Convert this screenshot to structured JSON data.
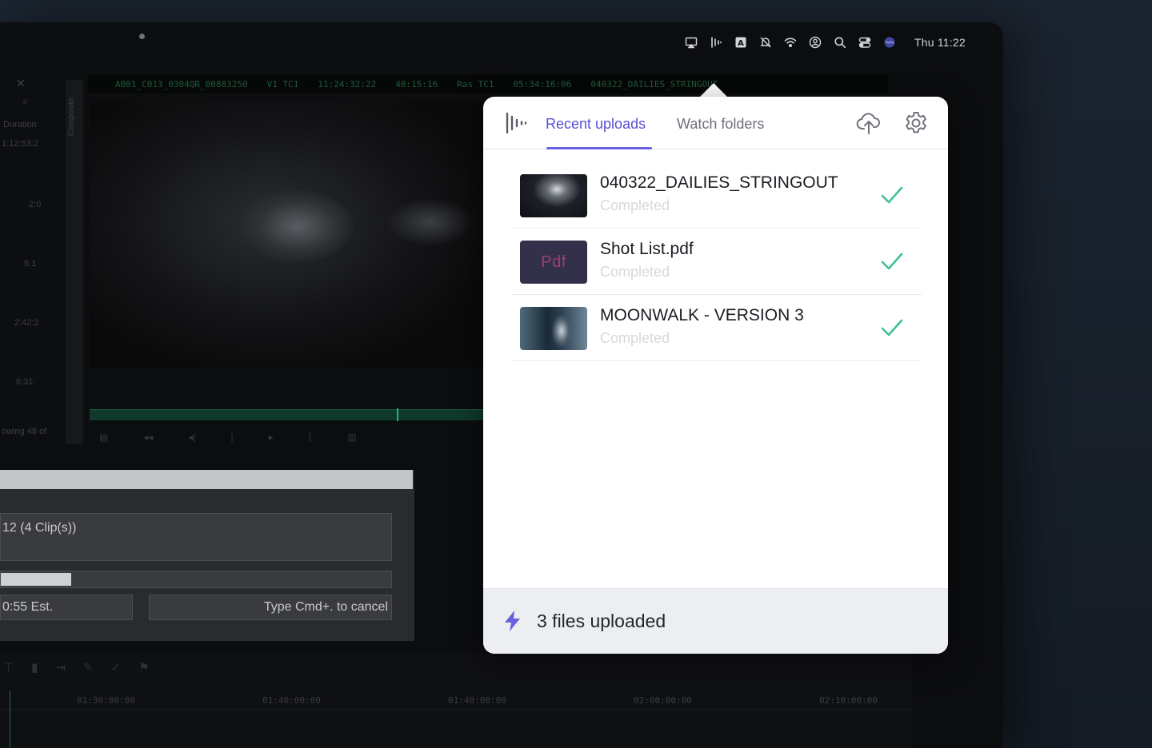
{
  "menubar": {
    "clock": "Thu 11:22",
    "icons": [
      "airplay-icon",
      "frameio-icon",
      "keyboard-a-icon",
      "mute-icon",
      "wifi-icon",
      "user-icon",
      "search-icon",
      "control-center-icon",
      "siri-icon"
    ]
  },
  "editor": {
    "clip_name": "A001_C013_0304QR_00883250",
    "track": "V1  TC1",
    "timecode_1": "11:24:32:22",
    "timecode_2": "48:15:16",
    "ras": "Ras  TC1",
    "timecode_3": "05:34:16:06",
    "clip_name_2": "040322_DAILIES_STRINGOUT",
    "left_panel": {
      "duration_label": "Duration",
      "duration_value": "1:12:53:2",
      "values": [
        "2:0",
        "5:1",
        "2:42:2",
        "6:31:"
      ],
      "footer": "owing 48 of"
    },
    "side_strip_label": "Composite",
    "ruler_ticks": [
      "01:30:00:00",
      "01:40:00:00",
      "01:40:00:00",
      "02:00:00:00",
      "02:10:00:00"
    ]
  },
  "render_dialog": {
    "summary": "12    (4 Clip(s))",
    "progress": 0.18,
    "estimate": "0:55 Est.",
    "cancel_hint": "Type Cmd+. to cancel"
  },
  "popover": {
    "tabs": {
      "recent": "Recent uploads",
      "watch": "Watch folders"
    },
    "uploads": [
      {
        "name": "040322_DAILIES_STRINGOUT",
        "status": "Completed",
        "thumb": "video"
      },
      {
        "name": "Shot List.pdf",
        "status": "Completed",
        "thumb": "pdf",
        "thumb_label": "Pdf"
      },
      {
        "name": "MOONWALK - VERSION 3",
        "status": "Completed",
        "thumb": "video"
      }
    ],
    "footer": {
      "text": "3 files uploaded"
    },
    "colors": {
      "accent": "#5a4fd1",
      "success": "#3ebf9a"
    }
  }
}
